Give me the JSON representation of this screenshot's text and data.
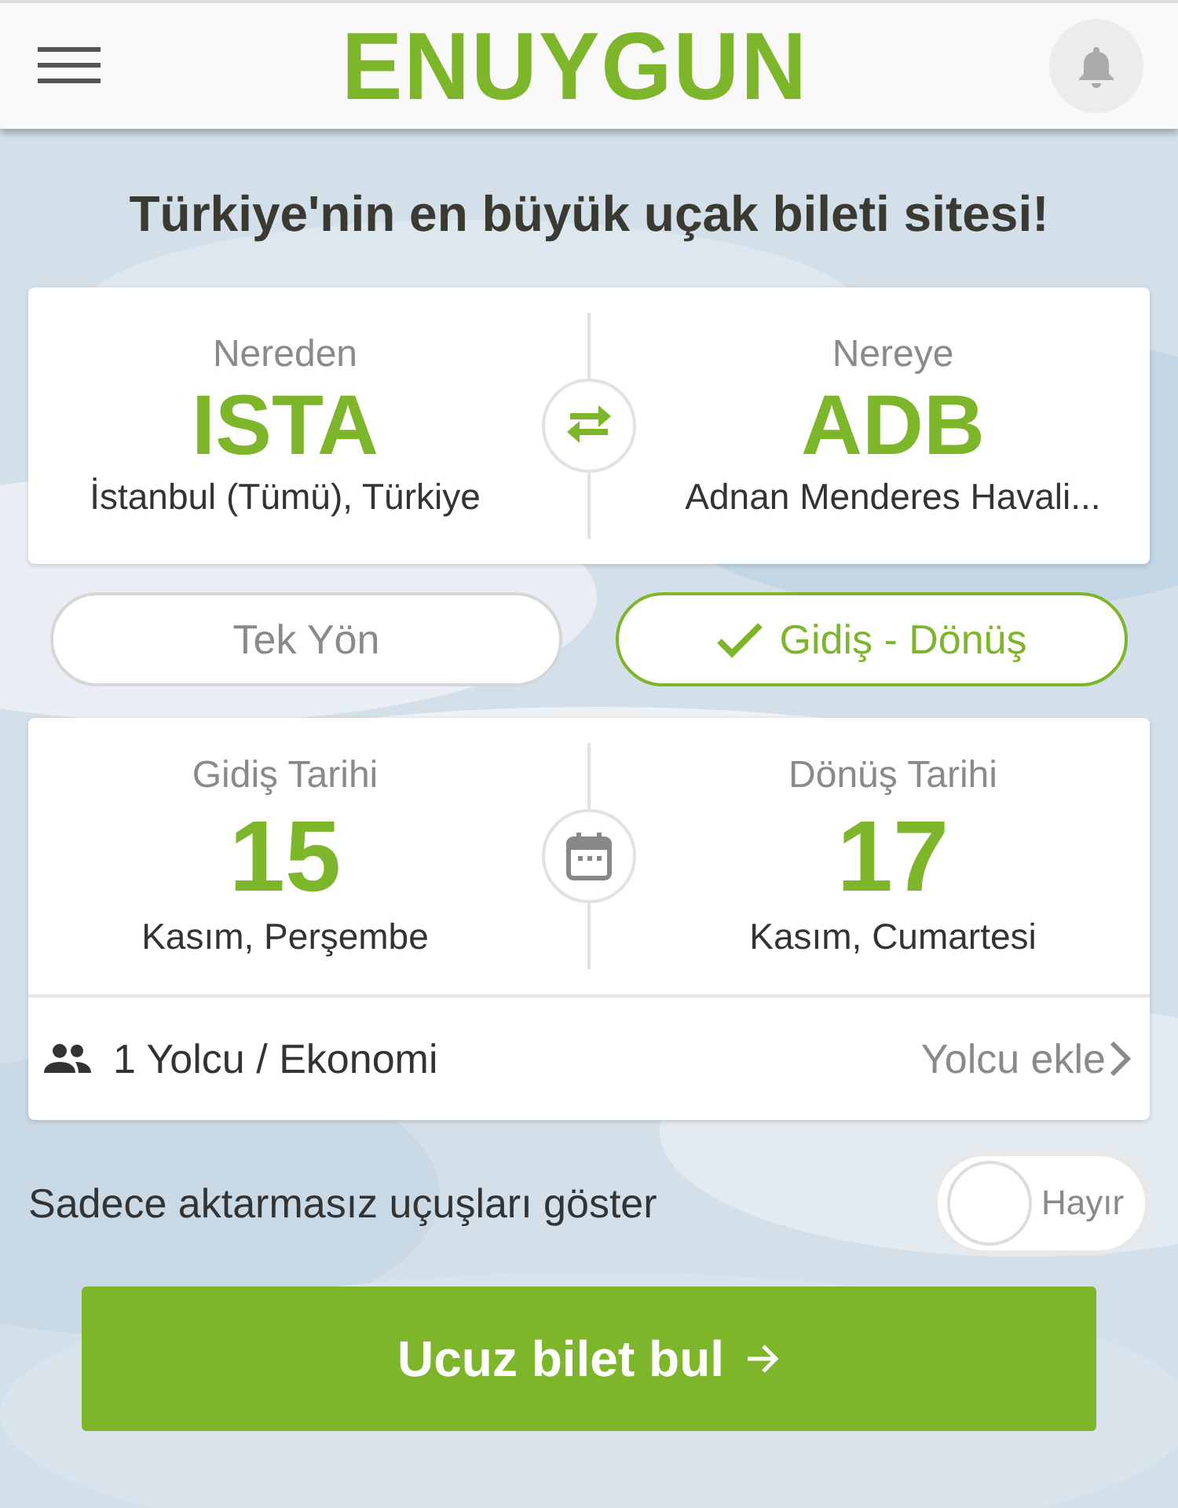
{
  "header": {
    "logo": "ENUYGUN"
  },
  "headline": "Türkiye'nin en büyük uçak bileti sitesi!",
  "route": {
    "from": {
      "label": "Nereden",
      "code": "ISTA",
      "name": "İstanbul (Tümü), Türkiye"
    },
    "to": {
      "label": "Nereye",
      "code": "ADB",
      "name": "Adnan Menderes Havali..."
    }
  },
  "trip_types": [
    {
      "label": "Tek Yön",
      "selected": false
    },
    {
      "label": "Gidiş - Dönüş",
      "selected": true
    }
  ],
  "dates": [
    {
      "label": "Gidiş Tarihi",
      "day": "15",
      "detail": "Kasım, Perşembe"
    },
    {
      "label": "Dönüş Tarihi",
      "day": "17",
      "detail": "Kasım, Cumartesi"
    }
  ],
  "passengers": {
    "count": "1 Yolcu",
    "separator": "/",
    "cabin": "Ekonomi",
    "add": "Yolcu ekle"
  },
  "direct_only": {
    "label": "Sadece aktarmasız uçuşları göster",
    "on": false,
    "state_text": "Hayır"
  },
  "search_button": "Ucuz bilet bul"
}
